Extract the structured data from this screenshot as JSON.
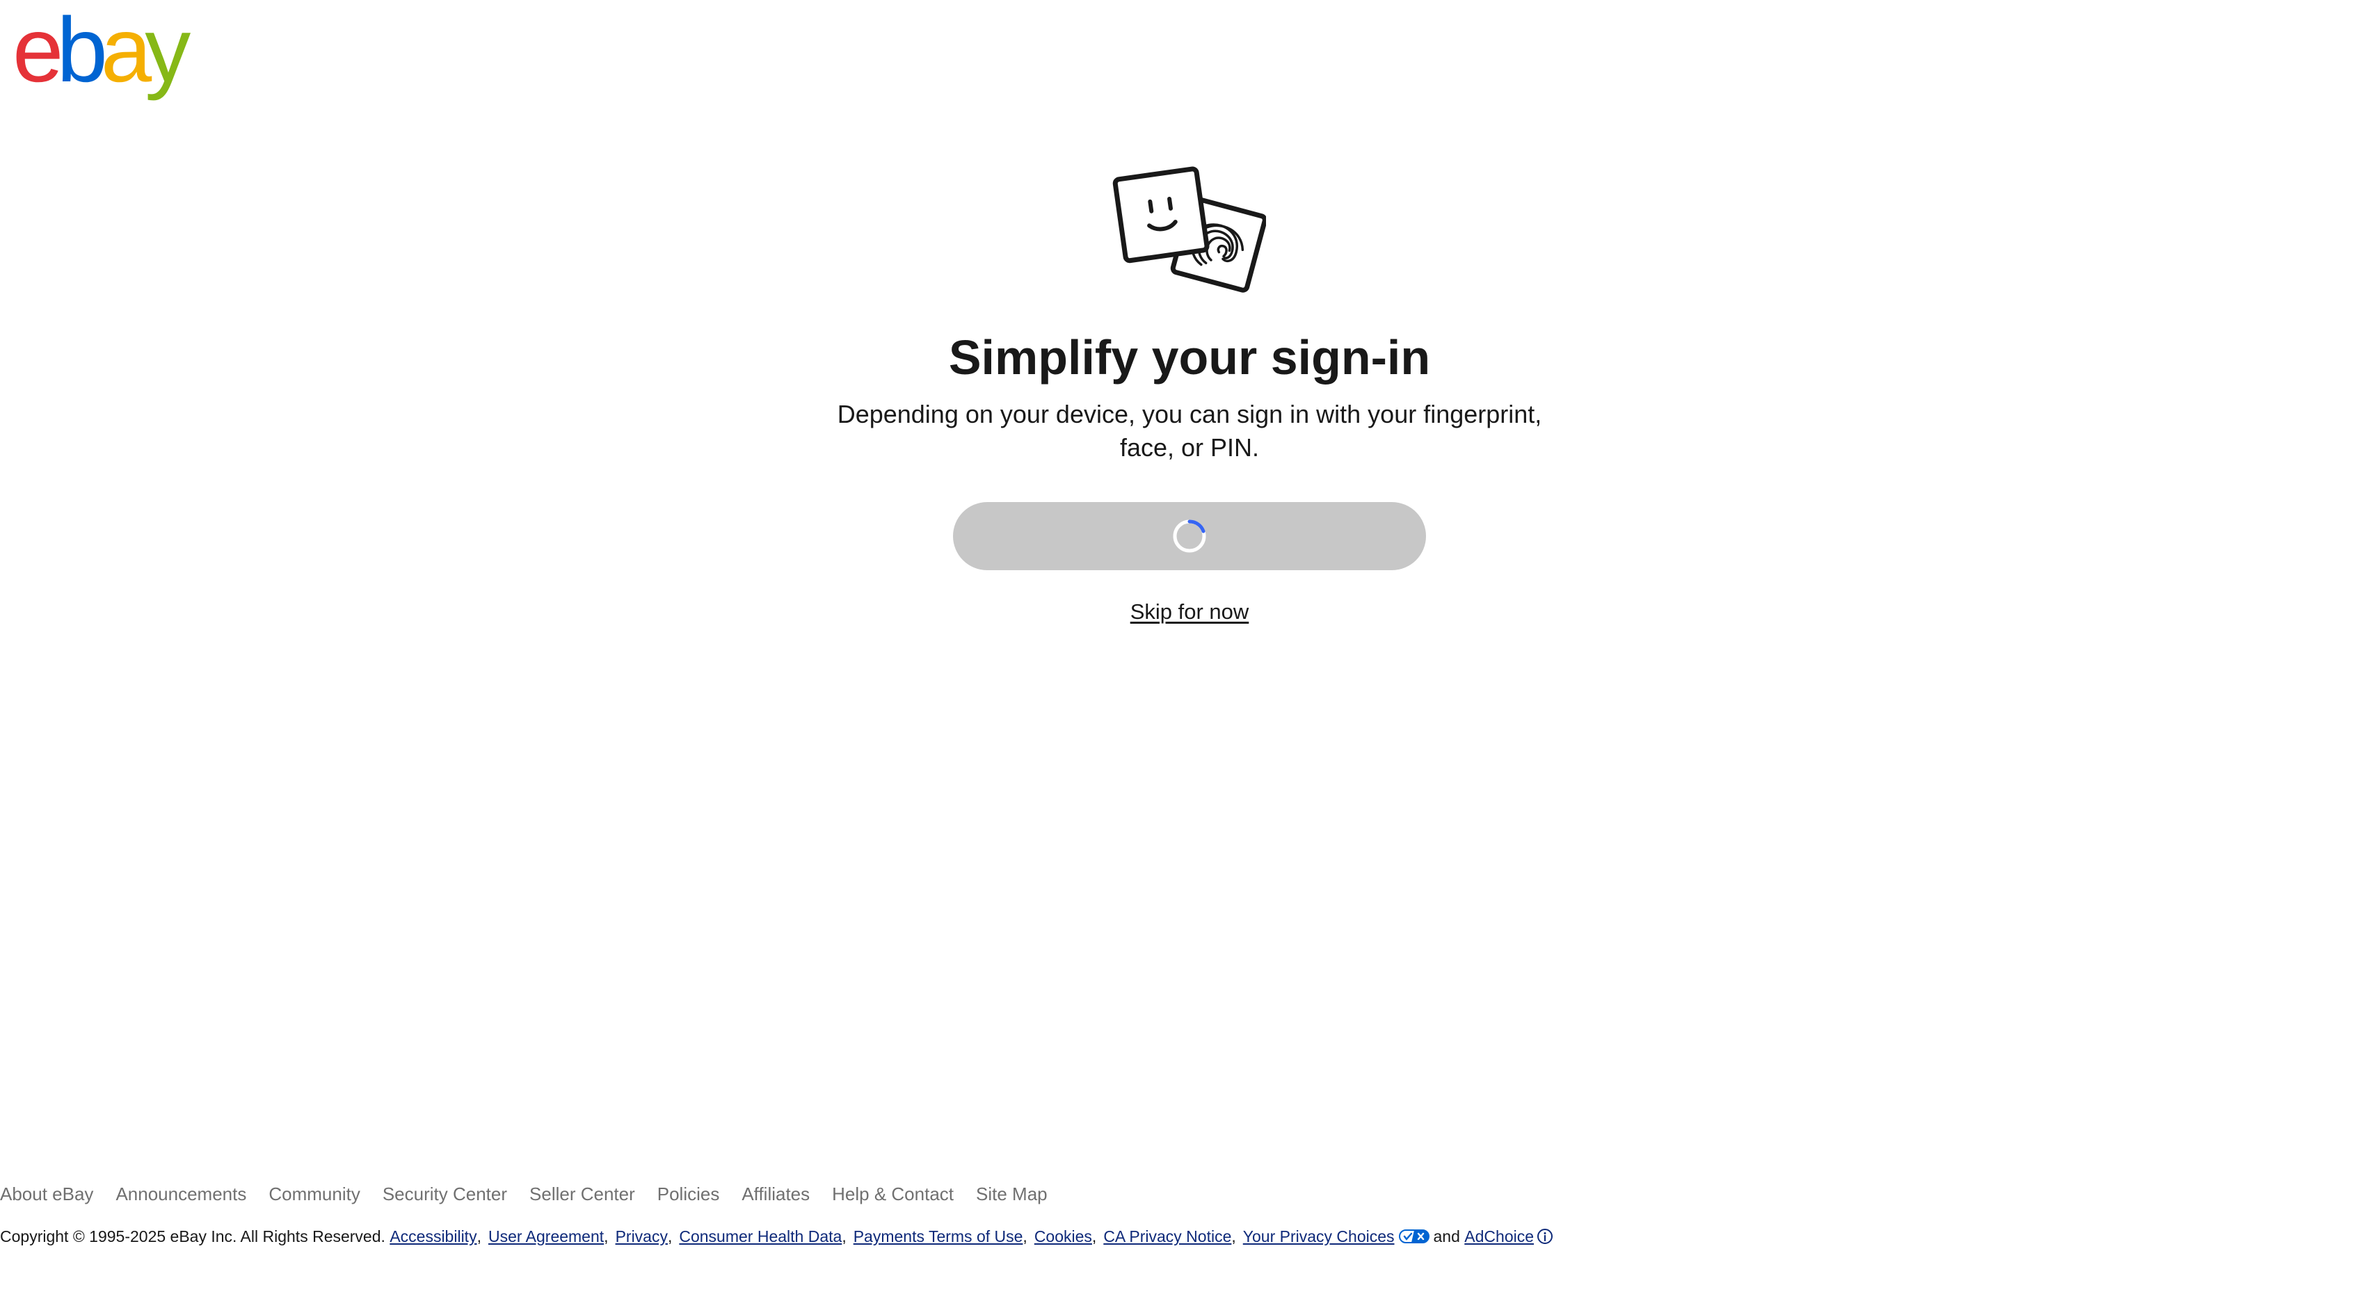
{
  "brand": {
    "logo_letters": [
      "e",
      "b",
      "a",
      "y"
    ],
    "colors": {
      "e": "#e53238",
      "b": "#0064d2",
      "a": "#f5af02",
      "y": "#86b817"
    }
  },
  "main": {
    "illustration_icon": "face-and-fingerprint-icon",
    "headline": "Simplify your sign-in",
    "description": "Depending on your device, you can sign in with your fingerprint, face, or PIN.",
    "primary_button": {
      "state": "loading",
      "icon": "loading-spinner-icon",
      "background": "#c7c7c7"
    },
    "skip_link": "Skip for now"
  },
  "footer": {
    "nav": [
      "About eBay",
      "Announcements",
      "Community",
      "Security Center",
      "Seller Center",
      "Policies",
      "Affiliates",
      "Help & Contact",
      "Site Map"
    ],
    "copyright": "Copyright © 1995-2025 eBay Inc. All Rights Reserved.",
    "legal_links": [
      "Accessibility",
      "User Agreement",
      "Privacy",
      "Consumer Health Data",
      "Payments Terms of Use",
      "Cookies",
      "CA Privacy Notice",
      "Your Privacy Choices"
    ],
    "privacy_choices_icon": "privacy-choices-toggle-icon",
    "conjunction": "and",
    "adchoice_label": "AdChoice",
    "adchoice_icon": "info-icon"
  }
}
